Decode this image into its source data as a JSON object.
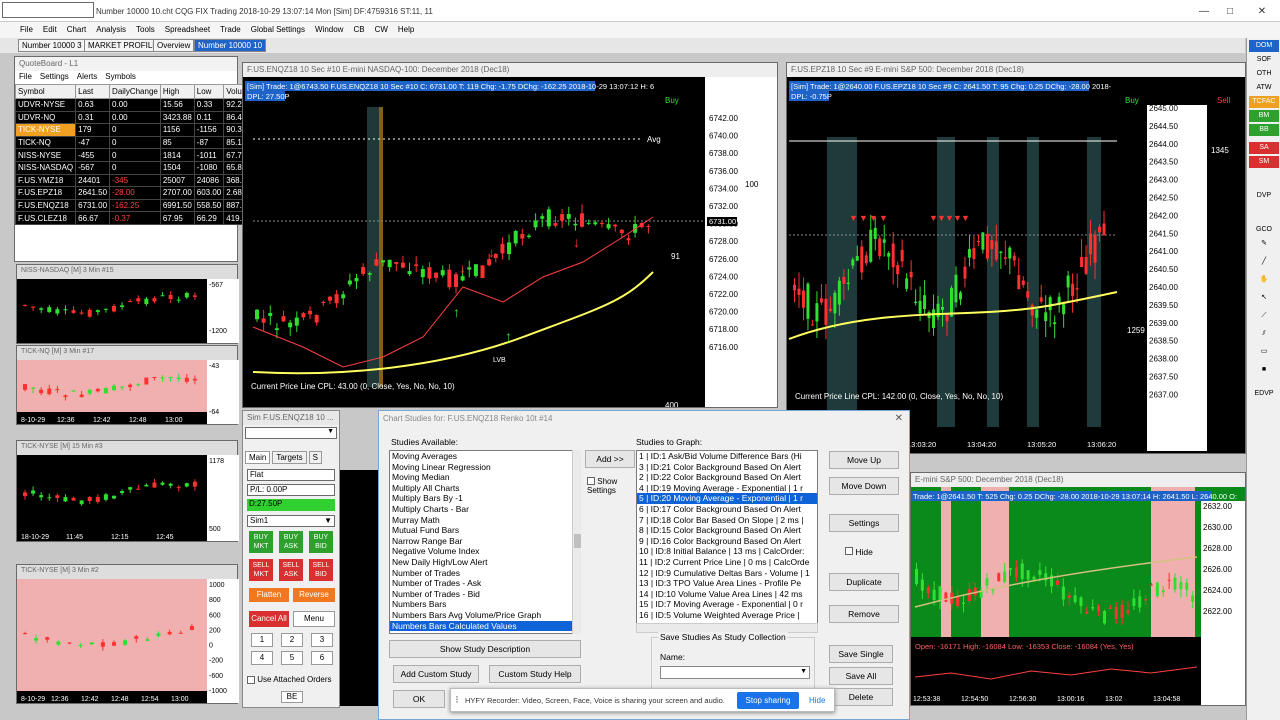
{
  "app": {
    "title": "Number 10000 10.cht   CQG FIX Trading 2018-10-29  13:07:14 Mon [Sim]   DF:4759316   ST:11, 11"
  },
  "menu": [
    "File",
    "Edit",
    "Chart",
    "Analysis",
    "Tools",
    "Spreadsheet",
    "Trade",
    "Global Settings",
    "Window",
    "CB",
    "CW",
    "Help"
  ],
  "tabs": [
    "Number 10000 3",
    "MARKET PROFILE",
    "Overview",
    "Number 10000 10"
  ],
  "right_toolbar": [
    "DOM",
    "SOF",
    "OTH",
    "ATW",
    "TCFAC",
    "BM",
    "BB",
    "SA",
    "SM",
    "DVP",
    "GCO",
    "EDVP"
  ],
  "quoteboard": {
    "title": "QuoteBoard - L1",
    "menu": [
      "File",
      "Settings",
      "Alerts",
      "Symbols"
    ],
    "columns": [
      "Symbol",
      "Last",
      "DailyChange",
      "High",
      "Low",
      "Volume"
    ],
    "rows": [
      [
        "UDVR-NYSE",
        "0.63",
        "0.00",
        "15.56",
        "0.33",
        "92.2"
      ],
      [
        "UDVR-NQ",
        "0.31",
        "0.00",
        "3423.88",
        "0.11",
        "86.4"
      ],
      [
        "TICK-NYSE",
        "179",
        "0",
        "1156",
        "-1156",
        "90.3"
      ],
      [
        "TICK-NQ",
        "-47",
        "0",
        "85",
        "-87",
        "85.1"
      ],
      [
        "NISS-NYSE",
        "-455",
        "0",
        "1814",
        "-1011",
        "67.7"
      ],
      [
        "NISS-NASDAQ",
        "-567",
        "0",
        "1504",
        "-1080",
        "65.8"
      ],
      [
        "F.US.YMZ18",
        "24401",
        "-345",
        "25007",
        "24086",
        "368.0"
      ],
      [
        "F.US.EPZ18",
        "2641.50",
        "-28.00",
        "2707.00",
        "603.00",
        "2.689"
      ],
      [
        "F.US.ENQZ18",
        "6731.00",
        "-162.25",
        "6991.50",
        "558.50",
        "887.7"
      ],
      [
        "F.US.CLEZ18",
        "66.67",
        "-0.37",
        "67.95",
        "66.29",
        "419.6"
      ]
    ]
  },
  "minicharts": [
    {
      "title": "NISS-NASDAQ [M]  3 Min  #15",
      "axis": [
        "-567",
        "-1200"
      ]
    },
    {
      "title": "TICK-NQ [M]  3 Min  #17",
      "axis": [
        "-43",
        "-64"
      ],
      "times": [
        "8-10-29",
        "12:36",
        "12:42",
        "12:48",
        "13:00"
      ]
    },
    {
      "title": "TICK-NYSE [M]  15 Min  #3",
      "axis": [
        "1178",
        "500"
      ],
      "times": [
        "18-10-29",
        "11:45",
        "12:15",
        "12:45"
      ]
    },
    {
      "title": "TICK-NYSE [M]  3 Min  #2",
      "axis": [
        "1000",
        "800",
        "600",
        "200",
        "0",
        "-200",
        "-600",
        "-1000"
      ],
      "times": [
        "8-10-29",
        "12:36",
        "12:42",
        "12:48",
        "12:54",
        "13:00"
      ]
    }
  ],
  "chart_nq": {
    "wintitle": "F.US.ENQZ18  10 Sec  #10  E-mini NASDAQ-100: December 2018 (Dec18)",
    "header1": "[Sim]  Trade: 1@6743.50  F.US.ENQZ18  10 Sec  #10  C: 6731.00  T: 119  Chg: -1.75  DChg: -162.25  2018-10-29  13:07:12  H: 6",
    "header2": "DPL: 27.50P",
    "prices": [
      "6742.00",
      "6740.00",
      "6738.00",
      "6736.00",
      "6734.00",
      "6732.00",
      "6730.00",
      "6728.00",
      "6726.00",
      "6724.00",
      "6722.00",
      "6720.00",
      "6718.00",
      "6716.00"
    ],
    "footer": "Current Price Line   CPL: 43.00   (0, Close, Yes, No, No, 10)",
    "buy": "Buy",
    "sell": "Sell",
    "avg": "Avg",
    "price_tag": "6731.00",
    "lvb": "LVB",
    "axis2": [
      "100",
      "91",
      "400"
    ]
  },
  "chart_es": {
    "wintitle": "F.US.EPZ18  10 Sec  #9  E-mini S&P 500: December 2018 (Dec18)",
    "header1": "[Sim]  Trade: 1@2640.00  F.US.EPZ18  10 Sec  #9  C: 2641.50  T: 95  Chg: 0.25  DChg: -28.00  2018-",
    "header2": "DPL: -0.75P",
    "prices": [
      "2645.00",
      "2644.50",
      "2644.00",
      "2643.50",
      "2643.00",
      "2642.50",
      "2642.00",
      "2641.50",
      "2641.00",
      "2640.50",
      "2640.00",
      "2639.50",
      "2639.00",
      "2638.50",
      "2638.00",
      "2637.50",
      "2637.00"
    ],
    "footer": "Current Price Line   CPL: 142.00   (0, Close, Yes, No, No, 10)",
    "times": [
      "13:03:20",
      "13:04:20",
      "13:05:20",
      "13:06:20"
    ],
    "buy": "Buy",
    "sell": "Sell",
    "side_nums": [
      "1345",
      "1259"
    ]
  },
  "chart_es2": {
    "wintitle": "E-mini S&P 500: December 2018 (Dec18)",
    "header": "Trade: 1@2641.50  T: 525  Chg: 0.25  DChg: -28.00  2018-10-29  13:07:14  H: 2641.50  L: 2640.00  O:",
    "prices": [
      "2632.00",
      "2630.00",
      "2628.00",
      "2626.00",
      "2624.00",
      "2622.00"
    ],
    "footer": "Open: -16171  High: -16084  Low: -16353  Close: -16084   (Yes, Yes)",
    "times": [
      "12:53:38",
      "12:54:50",
      "12:56:30",
      "13:00:16",
      "13:02",
      "13:04:58"
    ]
  },
  "order_panel": {
    "title": "Sim F.US.ENQZ18  10 ...",
    "tabs": [
      "Main",
      "Targets",
      "S"
    ],
    "flat": "Flat",
    "pl": "P/L: 0.00P",
    "dpl": "D:27.50P",
    "account": "Sim1",
    "buy_buttons": [
      "BUY MKT",
      "BUY ASK",
      "BUY BID"
    ],
    "sell_buttons": [
      "SELL MKT",
      "SELL ASK",
      "SELL BID"
    ],
    "flatten": "Flatten",
    "reverse": "Reverse",
    "cancel_all": "Cancel All",
    "menu": "Menu",
    "nums": [
      "1",
      "2",
      "3",
      "4",
      "5",
      "6"
    ],
    "attached": "Use Attached Orders",
    "be": "BE"
  },
  "dialog": {
    "title": "Chart Studies for: F.US.ENQZ18  Renko 10t  #14",
    "available_label": "Studies Available:",
    "graph_label": "Studies to Graph:",
    "available": [
      "Moving Averages",
      "Moving Linear Regression",
      "Moving Median",
      "Multiply All Charts",
      "Multiply Bars By -1",
      "Multiply Charts - Bar",
      "Murray Math",
      "Mutual Fund Bars",
      "Narrow Range Bar",
      "Negative Volume Index",
      "New Daily High/Low Alert",
      "Number of Trades",
      "Number of Trades - Ask",
      "Number of Trades - Bid",
      "Numbers Bars",
      "Numbers Bars Avg Volume/Price Graph",
      "Numbers Bars Calculated Values"
    ],
    "available_selected": 16,
    "graph": [
      "1 | ID:1  Ask/Bid Volume Difference Bars (Hi",
      "3 | ID:21  Color Background Based On Alert",
      "2 | ID:22  Color Background Based On Alert",
      "4 | ID:19  Moving Average - Exponential | 1 r",
      "5 | ID:20  Moving Average - Exponential | 1 r",
      "6 | ID:17  Color Background Based On Alert",
      "7 | ID:18  Color Bar Based On Slope | 2 ms |",
      "8 | ID:15  Color Background Based On Alert",
      "9 | ID:16  Color Background Based On Alert",
      "10 | ID:8  Initial Balance | 13 ms | CalcOrder:",
      "11 | ID:2  Current Price Line | 0 ms | CalcOrde",
      "12 | ID:9  Cumulative Deltas Bars - Volume | 1",
      "13 | ID:3  TPO Value Area Lines - Profile Pe",
      "14 | ID:10  Volume Value Area Lines | 42 ms",
      "15 | ID:7  Moving Average - Exponential | 0 r",
      "16 | ID:5  Volume Weighted Average Price |"
    ],
    "graph_selected": 4,
    "add": "Add >>",
    "show_settings": "Show Settings",
    "move_up": "Move Up",
    "move_down": "Move Down",
    "settings": "Settings",
    "hide": "Hide",
    "duplicate": "Duplicate",
    "remove": "Remove",
    "show_desc": "Show Study Description",
    "add_custom": "Add Custom Study",
    "custom_help": "Custom Study Help",
    "save_group": "Save Studies As Study Collection",
    "name_label": "Name:",
    "save_single": "Save Single",
    "save_all": "Save All",
    "delete": "Delete",
    "ok": "OK"
  },
  "toast": {
    "text": "HYFY Recorder: Video, Screen, Face, Voice is sharing your screen and audio.",
    "stop": "Stop sharing",
    "hide": "Hide"
  }
}
